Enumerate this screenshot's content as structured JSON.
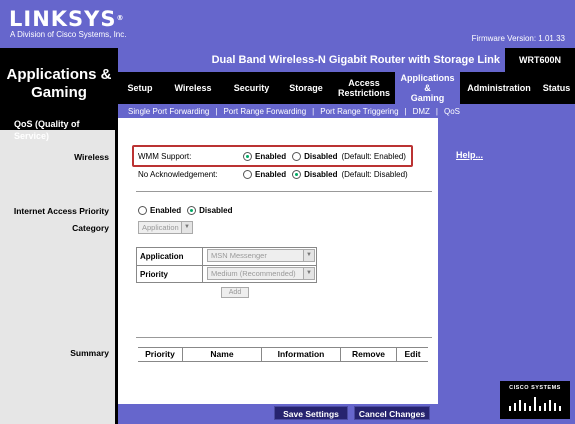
{
  "brand": {
    "logo": "LINKSYS",
    "logo_mark": "®",
    "subtitle": "A Division of Cisco Systems, Inc."
  },
  "firmware": "Firmware Version: 1.01.33",
  "section_title": "Applications & Gaming",
  "product_name": "Dual Band Wireless-N Gigabit Router with Storage Link",
  "model": "WRT600N",
  "tabs": [
    {
      "label": "Setup"
    },
    {
      "label": "Wireless"
    },
    {
      "label": "Security"
    },
    {
      "label": "Storage"
    },
    {
      "label": "Access Restrictions"
    },
    {
      "label": "Applications & Gaming"
    },
    {
      "label": "Administration"
    },
    {
      "label": "Status"
    }
  ],
  "subtabs": [
    {
      "label": "Single Port Forwarding"
    },
    {
      "label": "Port Range Forwarding"
    },
    {
      "label": "Port Range Triggering"
    },
    {
      "label": "DMZ"
    },
    {
      "label": "QoS"
    }
  ],
  "sidebar": {
    "heading": "QoS (Quality of Service)",
    "wireless": "Wireless",
    "internet_priority": "Internet Access Priority",
    "category": "Category",
    "summary": "Summary"
  },
  "wmm": {
    "label": "WMM Support:",
    "enabled": "Enabled",
    "disabled": "Disabled",
    "default": "(Default: Enabled)",
    "selected": "enabled"
  },
  "noack": {
    "label": "No Acknowledgement:",
    "enabled": "Enabled",
    "disabled": "Disabled",
    "default": "(Default: Disabled)",
    "selected": "disabled"
  },
  "internet_priority": {
    "enabled": "Enabled",
    "disabled": "Disabled",
    "selected": "disabled"
  },
  "category_select": "Application",
  "app_table": {
    "application_label": "Application",
    "application_value": "MSN Messenger",
    "priority_label": "Priority",
    "priority_value": "Medium (Recommended)",
    "add_label": "Add"
  },
  "summary_headers": [
    "Priority",
    "Name",
    "Information",
    "Remove",
    "Edit"
  ],
  "help_link": "Help...",
  "buttons": {
    "save": "Save Settings",
    "cancel": "Cancel Changes"
  },
  "cisco": "CISCO SYSTEMS",
  "colors": {
    "accent": "#6666cc",
    "dark": "#000000",
    "highlight_box": "#bb3333",
    "button": "#26236f"
  }
}
